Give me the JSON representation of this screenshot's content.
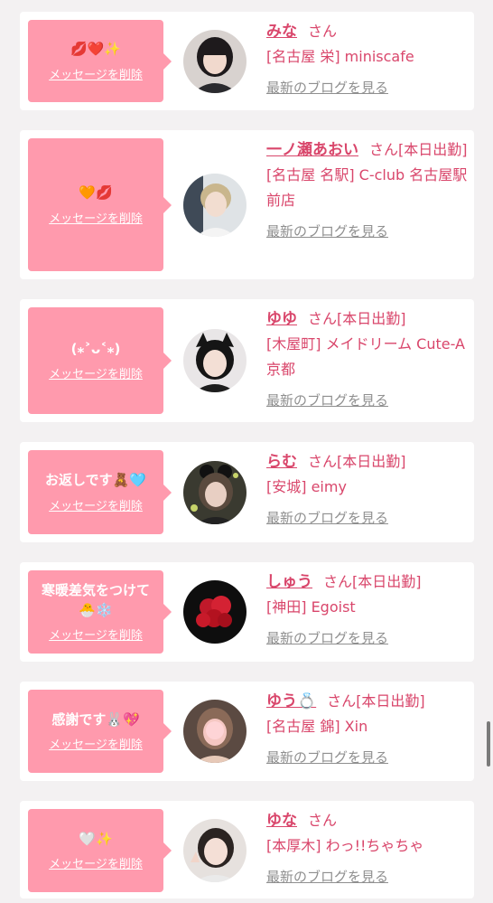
{
  "colors": {
    "accent": "#d9466b",
    "bubble": "#ff9aad",
    "link_gray": "#8f8f8f",
    "background": "#f3f1f2"
  },
  "entries": [
    {
      "message": "💋❤️✨",
      "delete_label": "メッセージを削除",
      "name": "みな",
      "honorific": "さん",
      "status": "",
      "shop": "[名古屋 栄] miniscafe",
      "blog_label": "最新のブログを見る"
    },
    {
      "message": "🧡💋",
      "delete_label": "メッセージを削除",
      "name": "一ノ瀬あおい",
      "honorific": "さん",
      "status": "[本日出勤]",
      "shop": "[名古屋 名駅] C-club 名古屋駅前店",
      "blog_label": "最新のブログを見る"
    },
    {
      "message": "(⁎˃ᴗ˂⁎)",
      "delete_label": "メッセージを削除",
      "name": "ゆゆ",
      "honorific": "さん",
      "status": "[本日出勤]",
      "shop": "[木屋町] メイドリーム Cute-A 京都",
      "blog_label": "最新のブログを見る"
    },
    {
      "message": "お返しです🧸🩵",
      "delete_label": "メッセージを削除",
      "name": "らむ",
      "honorific": "さん",
      "status": "[本日出勤]",
      "shop": "[安城] eimy",
      "blog_label": "最新のブログを見る"
    },
    {
      "message": "寒暖差気をつけて🐣❄️",
      "delete_label": "メッセージを削除",
      "name": "しゅう",
      "honorific": "さん",
      "status": "[本日出勤]",
      "shop": "[神田] Egoist",
      "blog_label": "最新のブログを見る"
    },
    {
      "message": "感謝です🐰💖",
      "delete_label": "メッセージを削除",
      "name": "ゆう💍",
      "honorific": "さん",
      "status": "[本日出勤]",
      "shop": "[名古屋 錦] Xin",
      "blog_label": "最新のブログを見る"
    },
    {
      "message": "🤍✨",
      "delete_label": "メッセージを削除",
      "name": "ゆな",
      "honorific": "さん",
      "status": "",
      "shop": "[本厚木] わっ!!ちゃちゃ",
      "blog_label": "最新のブログを見る"
    }
  ]
}
